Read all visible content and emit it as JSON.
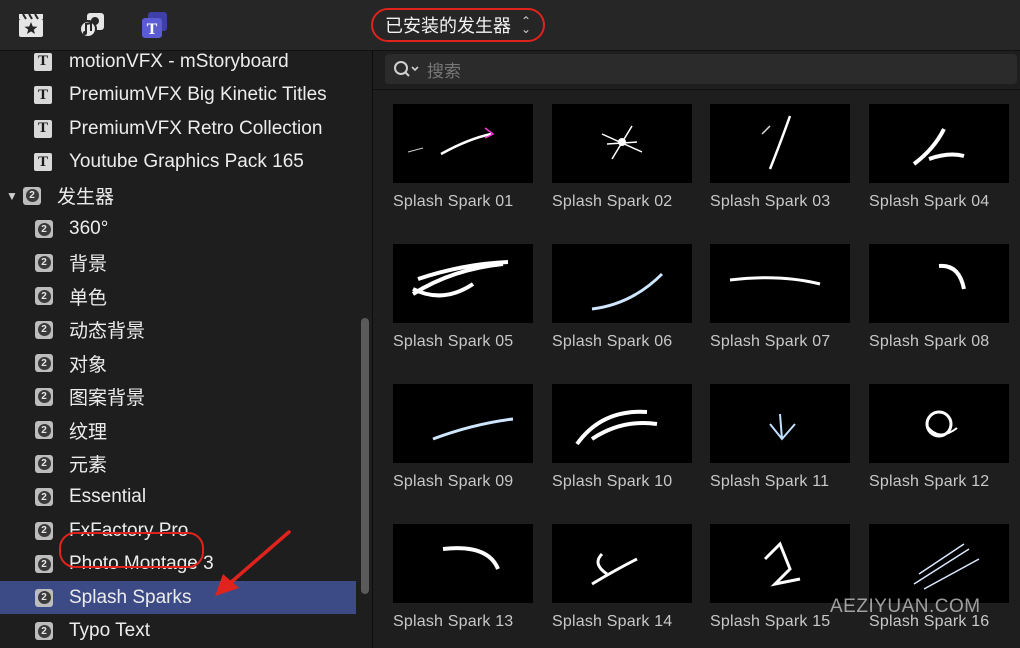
{
  "toolbar": {
    "title": "已安装的发生器",
    "icons": [
      "clapper-star-icon",
      "music-photos-icon",
      "titles-generators-icon"
    ]
  },
  "sidebar": {
    "items": [
      {
        "label": "motionVFX - mStoryboard",
        "icon": "title-icon"
      },
      {
        "label": "PremiumVFX Big Kinetic Titles",
        "icon": "title-icon"
      },
      {
        "label": "PremiumVFX Retro Collection",
        "icon": "title-icon"
      },
      {
        "label": "Youtube Graphics Pack 165",
        "icon": "title-icon"
      },
      {
        "label": "发生器",
        "icon": "generator-icon",
        "expanded": true
      },
      {
        "label": "360°",
        "icon": "generator-icon"
      },
      {
        "label": "背景",
        "icon": "generator-icon"
      },
      {
        "label": "单色",
        "icon": "generator-icon"
      },
      {
        "label": "动态背景",
        "icon": "generator-icon"
      },
      {
        "label": "对象",
        "icon": "generator-icon"
      },
      {
        "label": "图案背景",
        "icon": "generator-icon"
      },
      {
        "label": "纹理",
        "icon": "generator-icon"
      },
      {
        "label": "元素",
        "icon": "generator-icon"
      },
      {
        "label": "Essential",
        "icon": "generator-icon"
      },
      {
        "label": "FxFactory Pro",
        "icon": "generator-icon"
      },
      {
        "label": "Photo Montage 3",
        "icon": "generator-icon"
      },
      {
        "label": "Splash Sparks",
        "icon": "generator-icon",
        "selected": true
      },
      {
        "label": "Typo Text",
        "icon": "generator-icon"
      }
    ]
  },
  "search": {
    "placeholder": "搜索"
  },
  "tiles": [
    "Splash Spark 01",
    "Splash Spark 02",
    "Splash Spark 03",
    "Splash Spark 04",
    "Splash Spark 05",
    "Splash Spark 06",
    "Splash Spark 07",
    "Splash Spark 08",
    "Splash Spark 09",
    "Splash Spark 10",
    "Splash Spark 11",
    "Splash Spark 12",
    "Splash Spark 13",
    "Splash Spark 14",
    "Splash Spark 15",
    "Splash Spark 16"
  ],
  "watermark": "AEZIYUAN.COM",
  "colors": {
    "selection": "#3c4a86",
    "highlight": "#e0231c",
    "accent": "#5b5bd6"
  }
}
